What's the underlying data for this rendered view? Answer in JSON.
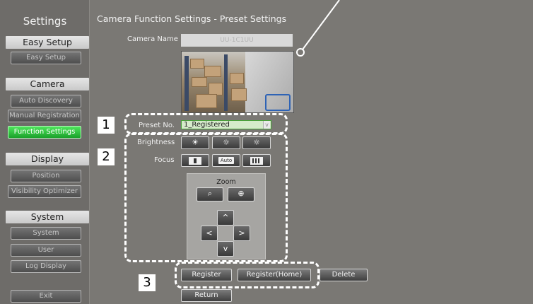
{
  "sidebar": {
    "title": "Settings",
    "easy_setup": {
      "label": "Easy Setup",
      "items": [
        "Easy Setup"
      ]
    },
    "camera": {
      "label": "Camera",
      "items": [
        "Auto Discovery",
        "Manual Registration",
        "Function Settings"
      ],
      "active": "Function Settings"
    },
    "display": {
      "label": "Display",
      "items": [
        "Position",
        "Visibility Optimizer"
      ]
    },
    "system": {
      "label": "System",
      "items": [
        "System",
        "User",
        "Log Display"
      ]
    },
    "exit": "Exit"
  },
  "main": {
    "title": "Camera Function Settings - Preset Settings",
    "camera_name_label": "Camera Name",
    "camera_name_value": "UU-1C1UU",
    "preset_label": "Preset No.",
    "preset_value": "1_Registered",
    "preset_dropdown_glyph": "v",
    "brightness_label": "Brightness",
    "focus_label": "Focus",
    "focus_auto": "Auto",
    "zoom_label": "Zoom",
    "dpad": {
      "up": "^",
      "left": "<",
      "right": ">",
      "down": "v"
    },
    "buttons": {
      "register": "Register",
      "register_home": "Register(Home)",
      "delete": "Delete",
      "return": "Return"
    }
  },
  "callouts": [
    "1",
    "2",
    "3"
  ],
  "colors": {
    "accent_active": "#2fc23f",
    "background": "#7a7874",
    "dash": "#ffffff"
  }
}
